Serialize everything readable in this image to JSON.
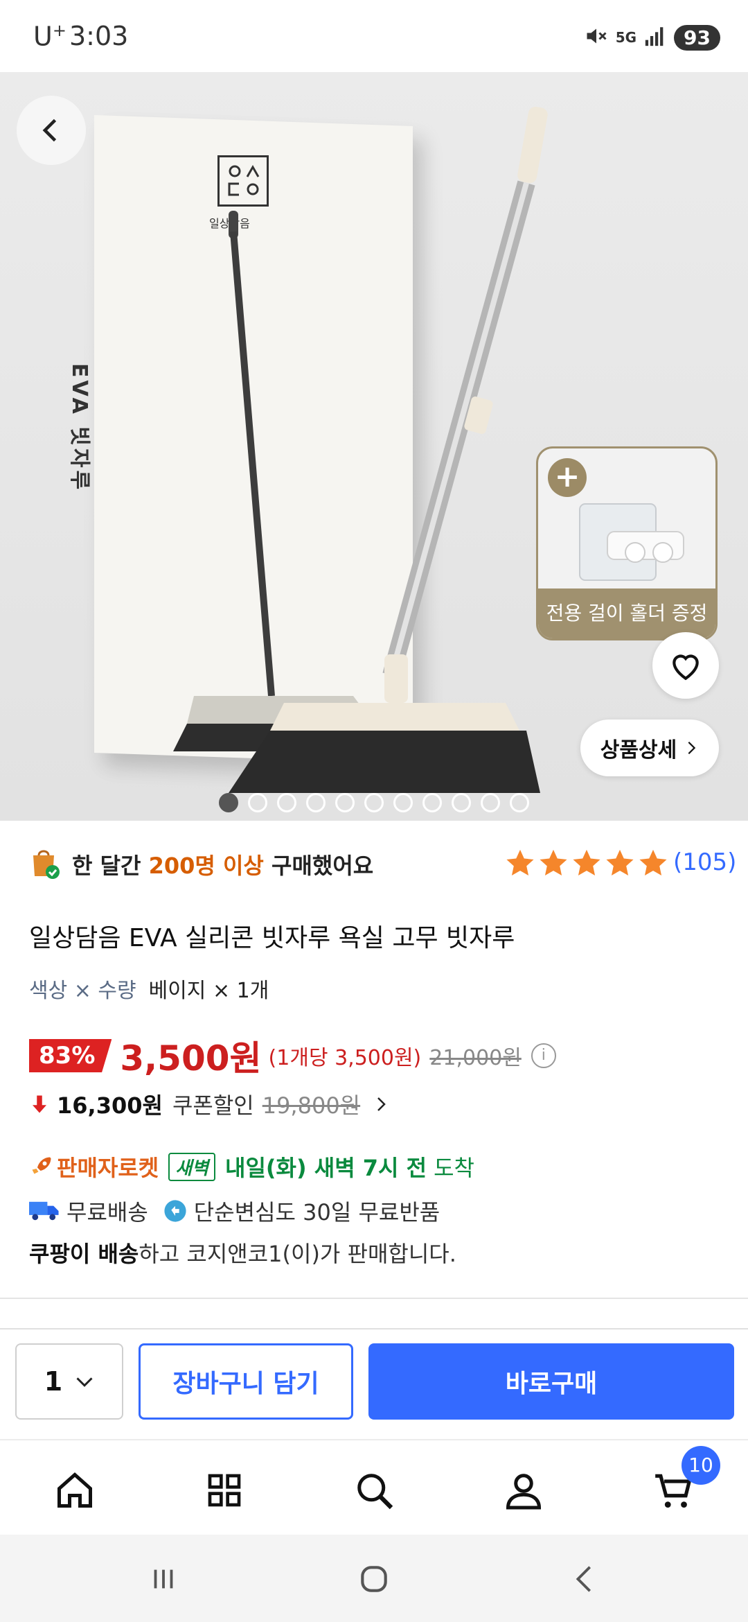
{
  "status_bar": {
    "carrier": "U",
    "carrier_sup": "+",
    "time": "3:03",
    "network": "5G",
    "battery": "93"
  },
  "hero": {
    "box_brand": "일상담음",
    "box_logo_text": "ㅇㅅ\nㄷㅇ",
    "box_side_text": "EVA 빗자루",
    "holder_label": "전용 걸이 홀더 증정",
    "detail_button": "상품상세",
    "image_count": 11,
    "active_image": 1
  },
  "purchase_info": {
    "prefix": "한 달간 ",
    "highlight": "200명 이상",
    "suffix": " 구매했어요",
    "rating": 5,
    "review_count": "(105)"
  },
  "product": {
    "title": "일상담음 EVA 실리콘 빗자루 욕실 고무 빗자루",
    "option_label": "색상 × 수량",
    "option_value": "베이지 × 1개"
  },
  "price": {
    "discount": "83%",
    "sale_price": "3,500원",
    "unit_price": "(1개당 3,500원)",
    "original_price": "21,000원",
    "coupon_price": "16,300원",
    "coupon_label": "쿠폰할인",
    "coupon_original": "19,800원"
  },
  "delivery": {
    "seller_rocket": "판매자로켓",
    "dawn_badge": "새벽",
    "delivery_time": "내일(화) 새벽 7시 전",
    "arrive": "도착",
    "free_shipping": "무료배송",
    "free_return": "단순변심도 30일 무료반품",
    "seller_bold": "쿠팡이 배송",
    "seller_rest": "하고 코지앤코1(이)가 판매합니다."
  },
  "action_bar": {
    "quantity": "1",
    "cart_button": "장바구니 담기",
    "buy_button": "바로구매"
  },
  "bottom_nav": {
    "cart_count": "10"
  },
  "colors": {
    "accent_blue": "#346aff",
    "price_red": "#cc1f1f",
    "rocket_orange": "#e0611a",
    "dawn_green": "#0a8a3e",
    "star_orange": "#f5862b"
  }
}
